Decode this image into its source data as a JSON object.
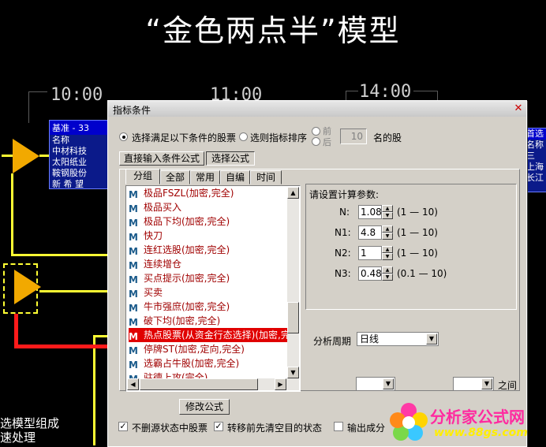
{
  "page_title": "“金色两点半”模型",
  "times": [
    "10:00",
    "11:00",
    "14:00"
  ],
  "left_box": {
    "header": "基准 - 33",
    "label": "名称",
    "rows": [
      "中材科技",
      "太阳纸业",
      "鞍钢股份",
      "新 希 望"
    ]
  },
  "right_box": {
    "rows": [
      "首选",
      "名称",
      "三 ",
      "上海",
      "长江"
    ]
  },
  "left_caption": [
    "选模型组成",
    "速处理"
  ],
  "dialog": {
    "title": "指标条件",
    "radio_select_label": "选择满足以下条件的股票",
    "radio_rank_label": "选则指标排序",
    "radio_front": "前",
    "radio_back": "后",
    "rank_count": "10",
    "rank_suffix": "名的股",
    "tab_input_formula": "直接输入条件公式",
    "tab_choose_formula": "选择公式",
    "category_tabs": [
      "分组",
      "全部",
      "常用",
      "自编",
      "时间"
    ],
    "formulas": [
      "极品FSZL(加密,完全)",
      "极品买入",
      "极品下均(加密,完全)",
      "快刀",
      "连红选股(加密,完全)",
      "连续增仓",
      "买点提示(加密,完全)",
      "买卖",
      "牛市强庶(加密,完全)",
      "破下均(加密,完全)",
      "热点股票(从资金行态选择)(加密,完",
      "停牌ST(加密,定向,完全)",
      "选霸占牛股(加密,完全)",
      "驻德上攻(完全)"
    ],
    "selected_index": 10,
    "params_title": "请设置计算参数:",
    "params": [
      {
        "name": "N:",
        "value": "1.08",
        "range": "(1  —  10)"
      },
      {
        "name": "N1:",
        "value": "4.8",
        "range": "(1  —  10)"
      },
      {
        "name": "N2:",
        "value": "1",
        "range": "(1  —  10)"
      },
      {
        "name": "N3:",
        "value": "0.48",
        "range": "(0.1  —  10)"
      }
    ],
    "period_label": "分析周期",
    "period_value": "日线",
    "between_label": "之间",
    "modify_button": "修改公式",
    "chk_no_delete": "不删源状态中股票",
    "chk_clear_before": "转移前先清空目的状态",
    "chk_output": "输出成分"
  },
  "watermark": {
    "brand": "分析家公式网",
    "url": "www.88gs.com"
  },
  "colors": {
    "accent_red": "#e00000",
    "node_yellow": "#f2a900",
    "line_yellow": "#ffff33",
    "stock_blue": "#0b1a8a"
  }
}
